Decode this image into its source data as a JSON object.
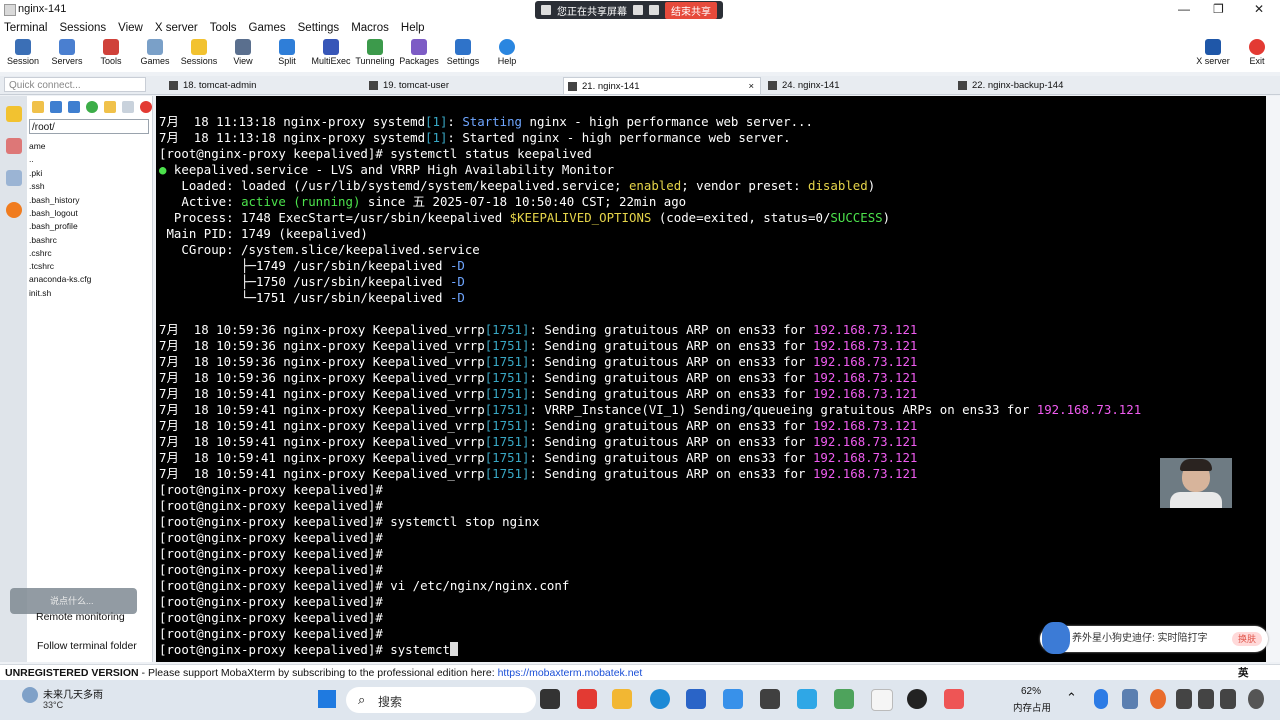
{
  "window": {
    "title": "nginx-141",
    "minimize": "—",
    "maximize": "❐",
    "close": "✕"
  },
  "share_bar": {
    "text": "您正在共享屏幕",
    "end": "结束共享"
  },
  "menu": [
    "Terminal",
    "Sessions",
    "View",
    "X server",
    "Tools",
    "Games",
    "Settings",
    "Macros",
    "Help"
  ],
  "toolbar": {
    "items": [
      {
        "label": "Session",
        "color": "#3b6fb6"
      },
      {
        "label": "Servers",
        "color": "#4a7fd0"
      },
      {
        "label": "Tools",
        "color": "#d0413a"
      },
      {
        "label": "Games",
        "color": "#7aa0c8"
      },
      {
        "label": "Sessions",
        "color": "#f2c230"
      },
      {
        "label": "View",
        "color": "#5a6f8e"
      },
      {
        "label": "Split",
        "color": "#2f7ed8"
      },
      {
        "label": "MultiExec",
        "color": "#3756b8"
      },
      {
        "label": "Tunneling",
        "color": "#3c9a4b"
      },
      {
        "label": "Packages",
        "color": "#7d5cc5"
      },
      {
        "label": "Settings",
        "color": "#2f73c9"
      },
      {
        "label": "Help",
        "color": "#2a86e0"
      }
    ],
    "xserver": "X server",
    "exit": "Exit"
  },
  "quick_connect": "Quick connect...",
  "tabs": [
    {
      "label": "18. tomcat-admin"
    },
    {
      "label": "19. tomcat-user"
    },
    {
      "label": "21. nginx-141",
      "close": "×"
    },
    {
      "label": "24. nginx-141"
    },
    {
      "label": "22. nginx-backup-144"
    }
  ],
  "sidebar": {
    "path": "/root/",
    "files": [
      "ame",
      "..",
      ".pki",
      ".ssh",
      ".bash_history",
      ".bash_logout",
      ".bash_profile",
      ".bashrc",
      ".cshrc",
      ".tcshrc",
      "anaconda-ks.cfg",
      "init.sh"
    ],
    "chat_placeholder": "说点什么...",
    "remote_monitoring": "Remote monitoring",
    "follow_folder": "Follow terminal folder"
  },
  "terminal": {
    "prompt": "[root@nginx-proxy keepalived]#",
    "line1": {
      "date": "7月  18 11:13:18 nginx-proxy systemd",
      "pid": "[1]",
      "sep": ": ",
      "starting": "Starting",
      "rest": " nginx - high performance web server..."
    },
    "line2": {
      "date": "7月  18 11:13:18 nginx-proxy systemd",
      "pid": "[1]",
      "text": ": Started nginx - high performance web server."
    },
    "cmd_status": " systemctl status keepalived",
    "svc_dot": "●",
    "svc_name": " keepalived.service - LVS and VRRP High Availability Monitor",
    "loaded_pre": "   Loaded: loaded (/usr/lib/systemd/system/keepalived.service; ",
    "enabled": "enabled",
    "loaded_mid": "; vendor preset: ",
    "disabled": "disabled",
    "loaded_end": ")",
    "active_pre": "   Active: ",
    "active": "active (running)",
    "active_post": " since 五 2025-07-18 10:50:40 CST; 22min ago",
    "process_pre": "  Process: 1748 ExecStart=/usr/sbin/keepalived ",
    "options_var": "$KEEPALIVED_OPTIONS",
    "process_mid": " (code=exited, status=0/",
    "success": "SUCCESS",
    "process_end": ")",
    "mainpid": " Main PID: 1749 (keepalived)",
    "cgroup": "   CGroup: /system.slice/keepalived.service",
    "tree": [
      {
        "prefix": "           ├─1749 /usr/sbin/keepalived ",
        "flag": "-D"
      },
      {
        "prefix": "           ├─1750 /usr/sbin/keepalived ",
        "flag": "-D"
      },
      {
        "prefix": "           └─1751 /usr/sbin/keepalived ",
        "flag": "-D"
      }
    ],
    "arp_pre_36": "7月  18 10:59:36 nginx-proxy Keepalived_vrrp",
    "arp_pre_41": "7月  18 10:59:41 nginx-proxy Keepalived_vrrp",
    "arp_pid": "[1751]",
    "arp_mid": ": Sending gratuitous ARP on ens33 for ",
    "ip": "192.168.73.121",
    "vrrp_mid": ": VRRP_Instance(VI_1) Sending/queueing gratuitous ARPs on ens33 for ",
    "cmd_stop": " systemctl stop nginx",
    "cmd_vi": " vi /etc/nginx/nginx.conf",
    "cmd_typing": " systemct"
  },
  "notice": {
    "text": "养外星小狗史迪仔: 实时陪打字",
    "button": "换肤"
  },
  "status": {
    "unregistered": "UNREGISTERED VERSION",
    "support": "  -  Please support MobaXterm by subscribing to the professional edition here:  ",
    "url": "https://mobaxterm.mobatek.net",
    "ime": "英"
  },
  "taskbar": {
    "weather_title": "未来几天多雨",
    "weather_temp": "33°C",
    "search": "搜索",
    "mem_pct": "62%",
    "mem_label": "内存占用"
  }
}
